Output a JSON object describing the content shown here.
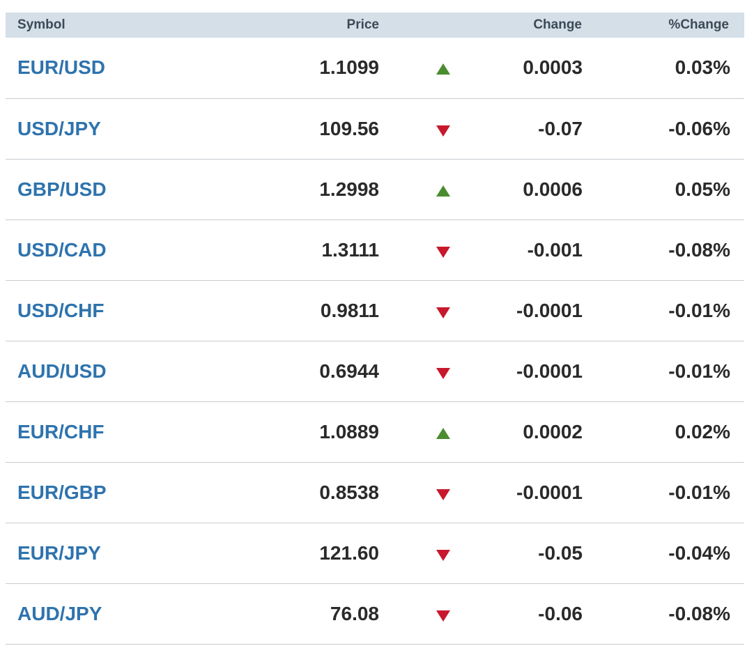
{
  "header": {
    "symbol": "Symbol",
    "price": "Price",
    "change": "Change",
    "pct_change": "%Change"
  },
  "colors": {
    "header_bg": "#d4dfe8",
    "symbol_link": "#2e73ad",
    "up": "#4a8c2f",
    "down": "#c8182d"
  },
  "rows": [
    {
      "symbol": "EUR/USD",
      "price": "1.1099",
      "direction": "up",
      "direction_icon": "triangle-up-icon",
      "change": "0.0003",
      "pct_change": "0.03%"
    },
    {
      "symbol": "USD/JPY",
      "price": "109.56",
      "direction": "down",
      "direction_icon": "triangle-down-icon",
      "change": "-0.07",
      "pct_change": "-0.06%"
    },
    {
      "symbol": "GBP/USD",
      "price": "1.2998",
      "direction": "up",
      "direction_icon": "triangle-up-icon",
      "change": "0.0006",
      "pct_change": "0.05%"
    },
    {
      "symbol": "USD/CAD",
      "price": "1.3111",
      "direction": "down",
      "direction_icon": "triangle-down-icon",
      "change": "-0.001",
      "pct_change": "-0.08%"
    },
    {
      "symbol": "USD/CHF",
      "price": "0.9811",
      "direction": "down",
      "direction_icon": "triangle-down-icon",
      "change": "-0.0001",
      "pct_change": "-0.01%"
    },
    {
      "symbol": "AUD/USD",
      "price": "0.6944",
      "direction": "down",
      "direction_icon": "triangle-down-icon",
      "change": "-0.0001",
      "pct_change": "-0.01%"
    },
    {
      "symbol": "EUR/CHF",
      "price": "1.0889",
      "direction": "up",
      "direction_icon": "triangle-up-icon",
      "change": "0.0002",
      "pct_change": "0.02%"
    },
    {
      "symbol": "EUR/GBP",
      "price": "0.8538",
      "direction": "down",
      "direction_icon": "triangle-down-icon",
      "change": "-0.0001",
      "pct_change": "-0.01%"
    },
    {
      "symbol": "EUR/JPY",
      "price": "121.60",
      "direction": "down",
      "direction_icon": "triangle-down-icon",
      "change": "-0.05",
      "pct_change": "-0.04%"
    },
    {
      "symbol": "AUD/JPY",
      "price": "76.08",
      "direction": "down",
      "direction_icon": "triangle-down-icon",
      "change": "-0.06",
      "pct_change": "-0.08%"
    }
  ]
}
